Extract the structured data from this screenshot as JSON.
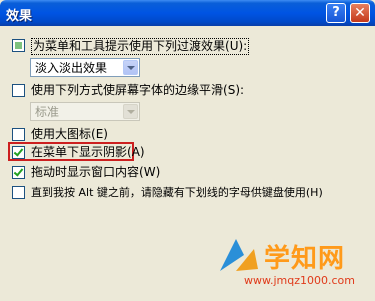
{
  "window": {
    "title": "效果",
    "help_label": "?",
    "close_label": "✕"
  },
  "options": {
    "menu_transition": {
      "label": "为菜单和工具提示使用下列过渡效果",
      "hotkey": "(U)",
      "state": "partial"
    },
    "transition_effect": {
      "value": "淡入淡出效果"
    },
    "smooth_edges": {
      "label": "使用下列方式使屏幕字体的边缘平滑",
      "hotkey": "(S)",
      "state": "unchecked"
    },
    "smooth_method": {
      "value": "标准"
    },
    "large_icons": {
      "label": "使用大图标",
      "hotkey": "(E)",
      "state": "unchecked"
    },
    "menu_shadow": {
      "label": "在菜单下显示阴影",
      "hotkey": "(A)",
      "state": "checked"
    },
    "drag_contents": {
      "label": "拖动时显示窗口内容",
      "hotkey": "(W)",
      "state": "checked"
    },
    "hide_underline": {
      "label": "直到我按 Alt 键之前，请隐藏有下划线的字母供键盘使用",
      "hotkey": "(H)",
      "state": "unchecked"
    }
  },
  "watermark": {
    "brand": "学知网",
    "url": "www.jmqz1000.com"
  }
}
